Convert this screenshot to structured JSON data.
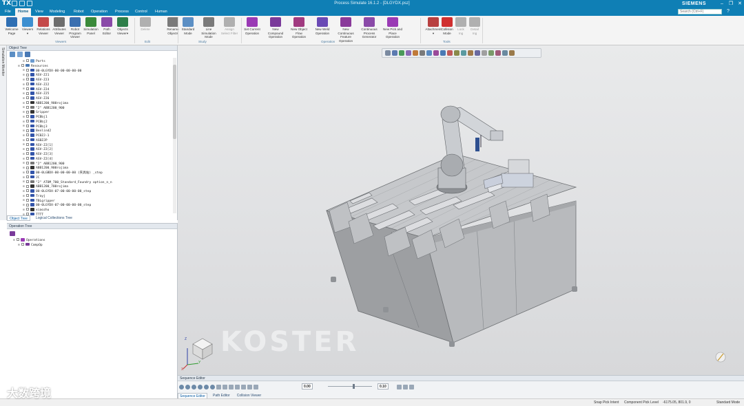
{
  "titlebar": {
    "app_logo": "TX",
    "title": "Process Simulate 16.1.2 - [DLGYDX.psz]",
    "brand": "SIEMENS",
    "controls": [
      "–",
      "❐",
      "✕"
    ]
  },
  "tabs": [
    "File",
    "Home",
    "View",
    "Modeling",
    "Robot",
    "Operation",
    "Process",
    "Control",
    "Human"
  ],
  "active_tab": "Home",
  "search_placeholder": "Search (Ctrl+F)",
  "ribbon": {
    "viewers": [
      {
        "label": "Welcome\nPage",
        "color": "#2f6fb3"
      },
      {
        "label": "Viewers\n▾",
        "color": "#3d8fd0"
      },
      {
        "label": "Relations\nViewer",
        "color": "#c44a4a"
      },
      {
        "label": "Attributes\nViewer",
        "color": "#6d6d6d"
      },
      {
        "label": "Robot Program\nViewer",
        "color": "#3a6fb0"
      },
      {
        "label": "Simulation\nPanel",
        "color": "#3a8a3a"
      },
      {
        "label": "Path\nEditor",
        "color": "#8a4aa8"
      },
      {
        "label": "Objects\nViewer▾",
        "color": "#2f7f4a"
      }
    ],
    "edit": [
      {
        "label": "Delete",
        "color": "#b0b0b0",
        "dim": true
      },
      {
        "label": "Rename\nObjects",
        "color": "#7a7a7a",
        "dim": false
      }
    ],
    "study": [
      {
        "label": "Standard\nMode",
        "color": "#5c8fc4"
      },
      {
        "label": "Line Simulation\nMode",
        "color": "#7a7a7a"
      },
      {
        "label": "Assign\nSelect Filter",
        "color": "#b0b0b0",
        "dim": true
      }
    ],
    "operation": [
      {
        "label": "Set Current\nOperation",
        "color": "#9a3ab5"
      },
      {
        "label": "New Compound\nOperation",
        "color": "#7a3a9a"
      },
      {
        "label": "New Object\nFlow Operation",
        "color": "#a03a80"
      },
      {
        "label": "New Weld\nOperation",
        "color": "#6a4ab5"
      },
      {
        "label": "New Continuous\nFeature Operation",
        "color": "#8a3a9a"
      },
      {
        "label": "Continuous\nProcess Generator",
        "color": "#8a4aa8"
      },
      {
        "label": "New Pick and\nPlace Operation",
        "color": "#9a3ab5"
      }
    ],
    "tools": [
      {
        "label": "Attachment\n▾",
        "color": "#b84040"
      },
      {
        "label": "Collision\nMode",
        "color": "#d03030"
      },
      {
        "label": "Lock\nIng",
        "color": "#b0b0b0",
        "dim": true
      },
      {
        "label": "Detail\nIng",
        "color": "#b0b0b0",
        "dim": true
      }
    ],
    "group_labels": [
      "Viewers",
      "Edit",
      "Study",
      "Operation",
      "Tools"
    ]
  },
  "side_strip_label": "Simulation Monitor",
  "object_tree": {
    "header": "Object Tree",
    "rows": [
      {
        "ind": 3,
        "text": "Parts",
        "icon": "#6b9bd0"
      },
      {
        "ind": 2,
        "text": "Resources",
        "icon": "#4a7ab5"
      },
      {
        "ind": 3,
        "text": "00-0LGYDX-00-00-00-00-00",
        "icon": "#3355aa"
      },
      {
        "ind": 3,
        "text": "ASV-ZJ1",
        "icon": "#3355aa"
      },
      {
        "ind": 3,
        "text": "ASV-ZJ3",
        "icon": "#3355aa"
      },
      {
        "ind": 3,
        "text": "ASV-ZJ2",
        "icon": "#3355aa"
      },
      {
        "ind": 3,
        "text": "ASV-ZJ4",
        "icon": "#3355aa"
      },
      {
        "ind": 3,
        "text": "ASV-ZJ5",
        "icon": "#3355aa"
      },
      {
        "ind": 3,
        "text": "ASV-ZJ6",
        "icon": "#3355aa"
      },
      {
        "ind": 3,
        "text": "ABB1200_900rojima",
        "icon": "#333333"
      },
      {
        "ind": 3,
        "text": "\"2\" ABB1200_900",
        "icon": "#777777"
      },
      {
        "ind": 3,
        "text": "Gripper",
        "icon": "#333333"
      },
      {
        "ind": 3,
        "text": "PCBbj1",
        "icon": "#3355aa"
      },
      {
        "ind": 3,
        "text": "PCBbj2",
        "icon": "#3355aa"
      },
      {
        "ind": 3,
        "text": "PCBbj3",
        "icon": "#3355aa"
      },
      {
        "ind": 3,
        "text": "Benlind2",
        "icon": "#3355aa"
      },
      {
        "ind": 3,
        "text": "PCBZJ-1",
        "icon": "#3355aa"
      },
      {
        "ind": 3,
        "text": "ASBZJP",
        "icon": "#3355aa"
      },
      {
        "ind": 3,
        "text": "ASV-ZJ[1]",
        "icon": "#3355aa"
      },
      {
        "ind": 3,
        "text": "ASV-ZJ[2]",
        "icon": "#3355aa"
      },
      {
        "ind": 3,
        "text": "ASV-ZJ[3]",
        "icon": "#3355aa"
      },
      {
        "ind": 3,
        "text": "ASV-ZJ[4]",
        "icon": "#3355aa"
      },
      {
        "ind": 3,
        "text": "\"2\" ABB1200_900",
        "icon": "#777777"
      },
      {
        "ind": 3,
        "text": "ABB1200_900rojima",
        "icon": "#333333"
      },
      {
        "ind": 3,
        "text": "00-0LGBDX-00-00-00-00 (夹具站) _step",
        "icon": "#3355aa"
      },
      {
        "ind": 3,
        "text": "JC",
        "icon": "#3355aa"
      },
      {
        "ind": 3,
        "text": "\"2\" ATOM_700_Standard_Foundry option_n_n",
        "icon": "#777777"
      },
      {
        "ind": 3,
        "text": "ABB1200_700rojima",
        "icon": "#333333"
      },
      {
        "ind": 3,
        "text": "00-0LGYDX-07-00-00-00-00_step",
        "icon": "#3355aa"
      },
      {
        "ind": 3,
        "text": "Trayj",
        "icon": "#3355aa"
      },
      {
        "ind": 3,
        "text": "TBLgripper",
        "icon": "#3355aa"
      },
      {
        "ind": 3,
        "text": "00-0LGYDX-07-00-00-00-00_step",
        "icon": "#3355aa"
      },
      {
        "ind": 3,
        "text": "xiaozhu",
        "icon": "#333333"
      },
      {
        "ind": 3,
        "text": "TTTT",
        "icon": "#3355aa"
      }
    ],
    "bottom_tabs": [
      "Object Tree",
      "Logical Collections Tree"
    ]
  },
  "operation_tree": {
    "header": "Operation Tree",
    "rows": [
      {
        "ind": 1,
        "text": "Operations",
        "icon": "#9a3ab5"
      },
      {
        "ind": 2,
        "text": "CompOp",
        "icon": "#7a3a9a"
      }
    ]
  },
  "viewport": {
    "watermark": "KOSTER",
    "axis_labels": [
      "Z",
      "Y",
      "X"
    ]
  },
  "sequence_editor": {
    "header": "Sequence Editor",
    "time_value": "0.00",
    "step_value": "0.10",
    "tabs": [
      "Sequence Editor",
      "Path Editor",
      "Collision Viewer"
    ]
  },
  "statusbar": {
    "snap": "Snap Pick Intent",
    "level": "Component Pick Level",
    "coords": "-6175.05, 801.9, 0",
    "mode": "Standard Mode"
  },
  "overlay_text": "大数跨境"
}
